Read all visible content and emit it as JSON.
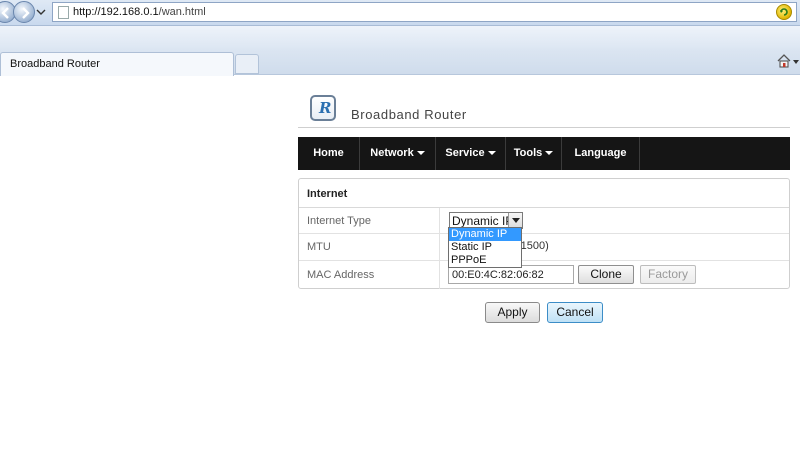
{
  "browser": {
    "url_host": "http://192.168.0.1",
    "url_path": "/wan.html",
    "tab_title": "Broadband Router"
  },
  "header": {
    "logo_letter": "R",
    "brand": "Broadband Router"
  },
  "menu": {
    "items": [
      {
        "label": "Home",
        "has_dropdown": false
      },
      {
        "label": "Network",
        "has_dropdown": true
      },
      {
        "label": "Service",
        "has_dropdown": true
      },
      {
        "label": "Tools",
        "has_dropdown": true
      },
      {
        "label": "Language",
        "has_dropdown": false
      }
    ]
  },
  "panel": {
    "title": "Internet",
    "rows": [
      {
        "label": "Internet Type"
      },
      {
        "label": "MTU"
      },
      {
        "label": "MAC Address"
      }
    ],
    "internet_type": {
      "selected": "Dynamic IP",
      "options": [
        "Dynamic IP",
        "Static IP",
        "PPPoE"
      ]
    },
    "mtu_hint": "-1500)",
    "mac_value": "00:E0:4C:82:06:82",
    "clone_label": "Clone",
    "factory_label": "Factory"
  },
  "actions": {
    "apply_label": "Apply",
    "cancel_label": "Cancel"
  },
  "colors": {
    "menu_bg": "#151515",
    "selection": "#3399ff"
  }
}
